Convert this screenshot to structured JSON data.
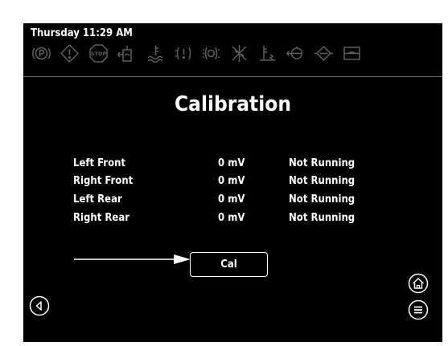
{
  "header": {
    "datetime": "Thursday 11:29 AM",
    "indicators": [
      {
        "icon": "parking-brake-icon"
      },
      {
        "icon": "warning-icon"
      },
      {
        "icon": "stop-icon",
        "text": "STOP"
      },
      {
        "icon": "hydraulic-oil-level-icon"
      },
      {
        "icon": "engine-coolant-temp-icon"
      },
      {
        "icon": "brake-wear-icon"
      },
      {
        "icon": "brake-pressure-icon"
      },
      {
        "icon": "hydraulic-filter-icon"
      },
      {
        "icon": "transmission-temp-icon"
      },
      {
        "icon": "hydraulic-pump-icon"
      },
      {
        "icon": "hydraulic-oil-filter-icon"
      },
      {
        "icon": "fuel-level-icon"
      }
    ]
  },
  "main": {
    "title": "Calibration",
    "rows": [
      {
        "name": "Left Front",
        "value": "0 mV",
        "status": "Not Running"
      },
      {
        "name": "Right Front",
        "value": "0 mV",
        "status": "Not Running"
      },
      {
        "name": "Left Rear",
        "value": "0 mV",
        "status": "Not Running"
      },
      {
        "name": "Right Rear",
        "value": "0 mV",
        "status": "Not Running"
      }
    ],
    "cal_button_label": "Cal"
  },
  "nav": {
    "back_icon": "back-icon",
    "home_icon": "home-icon",
    "menu_icon": "menu-icon"
  },
  "colors": {
    "screen_bg": "#000000",
    "indicator_dim": "#5f5f5f",
    "text": "#ffffff",
    "annotation_arrow": "#ffffff"
  }
}
